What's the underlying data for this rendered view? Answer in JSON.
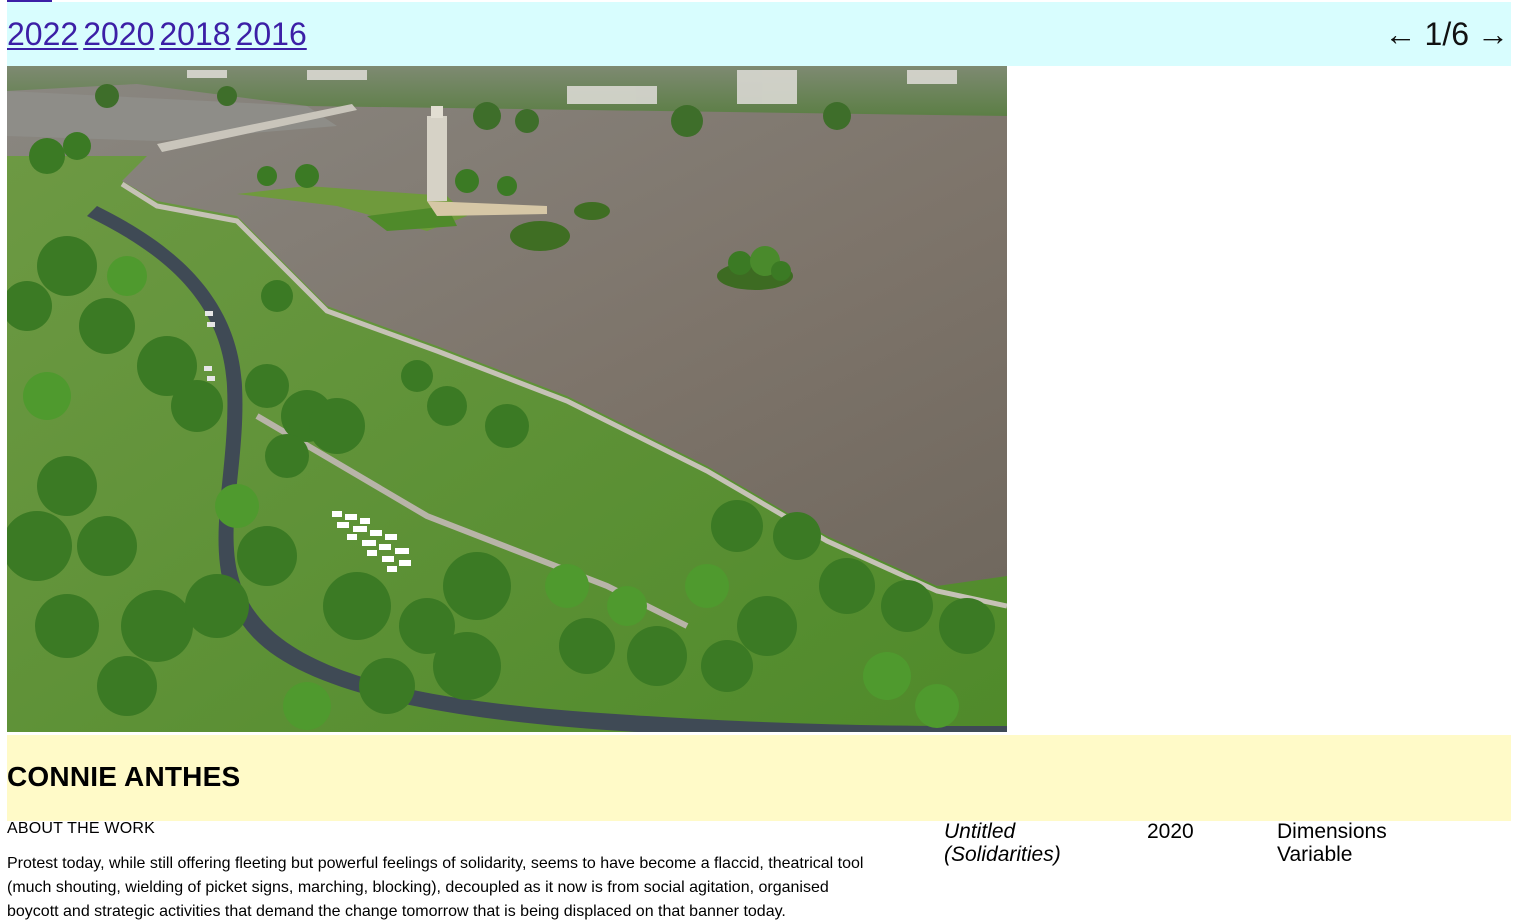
{
  "nav": {
    "years": [
      "2022",
      "2020",
      "2018",
      "2016"
    ],
    "prev_arrow": "←",
    "next_arrow": "→",
    "page_indicator": "1/6"
  },
  "artwork": {
    "artist": "CONNIE ANTHES",
    "about_heading": "ABOUT THE WORK",
    "about_text": "Protest today, while still offering fleeting but powerful feelings of solidarity, seems to have become a flaccid, theatrical tool (much shouting, wielding of picket signs, marching, blocking), decoupled as it now is from social agitation, organised boycott and strategic activities that demand the change tomorrow that is being displaced on that banner today.",
    "title": "Untitled (Solidarities)",
    "year": "2020",
    "dimensions": "Dimensions Variable"
  },
  "colors": {
    "year_bar": "#d8fdfe",
    "artist_bar": "#fffac8",
    "link": "#3c1fa6"
  }
}
